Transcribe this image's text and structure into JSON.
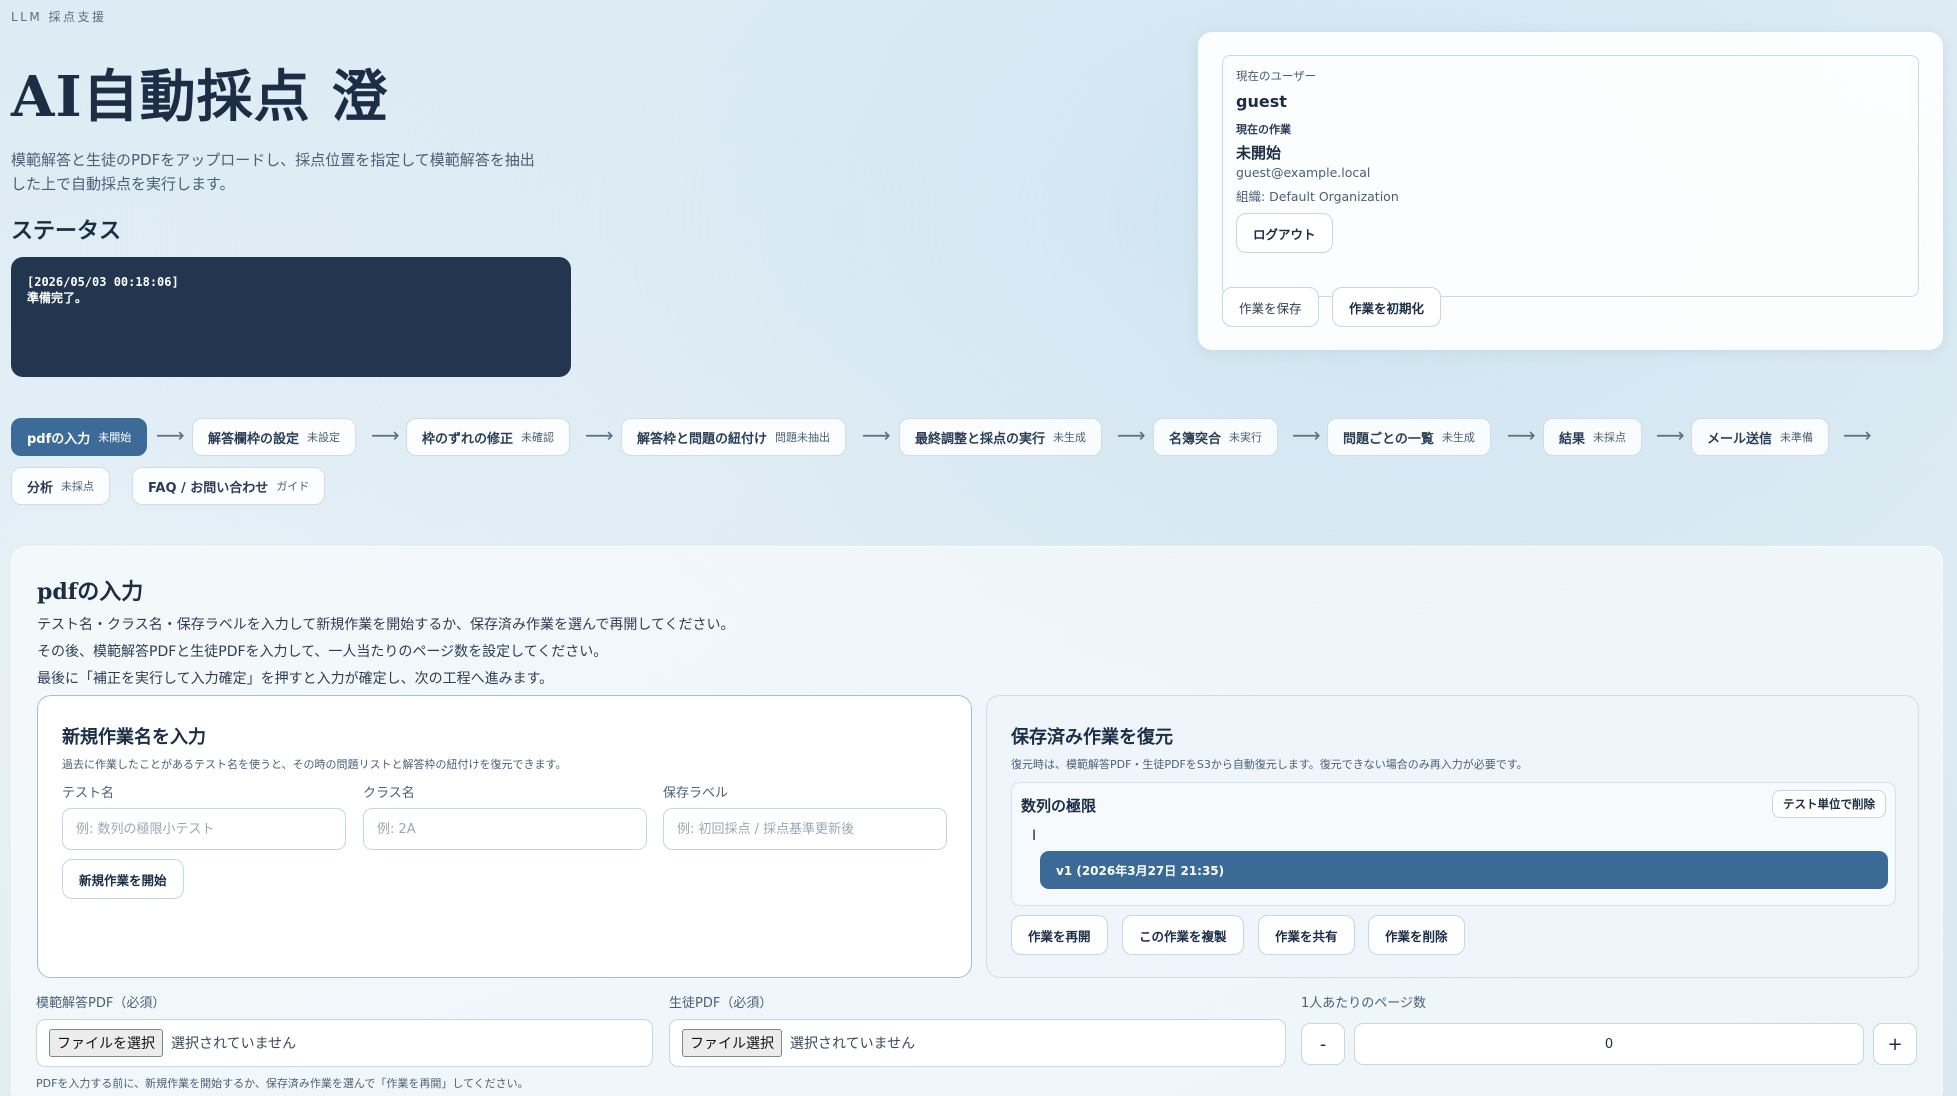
{
  "header": {
    "eyebrow": "LLM 採点支援",
    "title": "AI自動採点 澄",
    "description": "模範解答と生徒のPDFをアップロードし、採点位置を指定して模範解答を抽出した上で自動採点を実行します。",
    "status_heading": "ステータス",
    "console_lines": [
      "[2026/05/03 00:18:06]",
      "準備完了。"
    ]
  },
  "user": {
    "current_user_label": "現在のユーザー",
    "current_user": "guest",
    "current_work_label": "現在の作業",
    "current_work": "未開始",
    "email": "guest@example.local",
    "organization": "組織: Default Organization",
    "logout": "ログアウト",
    "save_work": "作業を保存",
    "reset_work": "作業を初期化"
  },
  "steps": [
    {
      "label": "pdfの入力",
      "status": "未開始"
    },
    {
      "label": "解答欄枠の設定",
      "status": "未設定"
    },
    {
      "label": "枠のずれの修正",
      "status": "未確認"
    },
    {
      "label": "解答枠と問題の紐付け",
      "status": "問題未抽出"
    },
    {
      "label": "最終調整と採点の実行",
      "status": "未生成"
    },
    {
      "label": "名簿突合",
      "status": "未実行"
    },
    {
      "label": "問題ごとの一覧",
      "status": "未生成"
    },
    {
      "label": "結果",
      "status": "未採点"
    },
    {
      "label": "メール送信",
      "status": "未準備"
    },
    {
      "label": "分析",
      "status": "未採点"
    },
    {
      "label": "FAQ / お問い合わせ",
      "status": "ガイド"
    }
  ],
  "section": {
    "title": "pdfの入力",
    "lines": [
      "テスト名・クラス名・保存ラベルを入力して新規作業を開始するか、保存済み作業を選んで再開してください。",
      "その後、模範解答PDFと生徒PDFを入力して、一人当たりのページ数を設定してください。",
      "最後に「補正を実行して入力確定」を押すと入力が確定し、次の工程へ進みます。"
    ]
  },
  "new_work": {
    "title": "新規作業名を入力",
    "description": "過去に作業したことがあるテスト名を使うと、その時の問題リストと解答枠の紐付けを復元できます。",
    "test_label": "テスト名",
    "test_placeholder": "例: 数列の極限小テスト",
    "class_label": "クラス名",
    "class_placeholder": "例: 2A",
    "save_label": "保存ラベル",
    "save_placeholder": "例: 初回採点 / 採点基準更新後",
    "start_button": "新規作業を開始"
  },
  "restore": {
    "title": "保存済み作業を復元",
    "description": "復元時は、模範解答PDF・生徒PDFをS3から自動復元します。復元できない場合のみ再入力が必要です。",
    "test_name": "数列の極限",
    "delete_by_test": "テスト単位で削除",
    "caret": "I",
    "version": "v1 (2026年3月27日 21:35)",
    "resume": "作業を再開",
    "duplicate": "この作業を複製",
    "share": "作業を共有",
    "delete": "作業を削除"
  },
  "inputs": {
    "model_pdf_label": "模範解答PDF（必須）",
    "model_pdf_button": "ファイルを選択",
    "model_pdf_status": "選択されていません",
    "student_pdf_label": "生徒PDF（必須）",
    "student_pdf_button": "ファイル選択",
    "student_pdf_status": "選択されていません",
    "pages_label": "1人あたりのページ数",
    "minus": "-",
    "plus": "+",
    "pages_value": "0",
    "note": "PDFを入力する前に、新規作業を開始するか、保存済み作業を選んで「作業を再開」してください。"
  }
}
